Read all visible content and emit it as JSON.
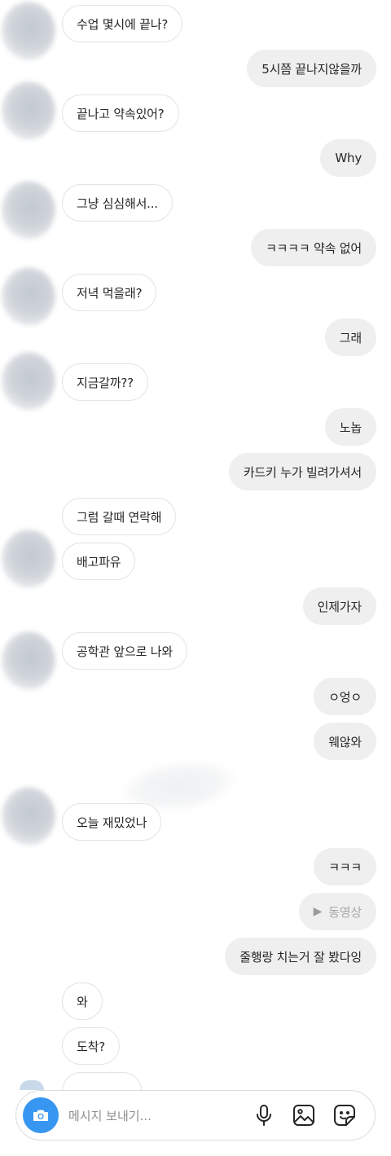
{
  "messages": [
    {
      "side": "in",
      "text": "수업 몇시에 끝나?"
    },
    {
      "side": "out",
      "text": "5시쯤 끝나지않을까"
    },
    {
      "side": "in",
      "text": "끝나고 약속있어?"
    },
    {
      "side": "out",
      "text": "Why"
    },
    {
      "side": "in",
      "text": "그냥 심심해서..."
    },
    {
      "side": "out",
      "text": "ㅋㅋㅋㅋ 약속 없어"
    },
    {
      "side": "in",
      "text": "저녁 먹을래?"
    },
    {
      "side": "out",
      "text": "그래"
    },
    {
      "side": "in",
      "text": "지금갈까??"
    },
    {
      "side": "out",
      "text": "노놉"
    },
    {
      "side": "out",
      "text": "카드키 누가 빌려가셔서"
    },
    {
      "side": "in",
      "text": "그럼 갈때 연락해"
    },
    {
      "side": "in",
      "text": "배고파유"
    },
    {
      "side": "out",
      "text": "인제가자"
    },
    {
      "side": "in",
      "text": "공학관 앞으로 나와"
    },
    {
      "side": "out",
      "text": "ㅇ엉ㅇ"
    },
    {
      "side": "out",
      "text": "웨않와"
    },
    {
      "side": "in",
      "text": "오늘 재밌었나"
    },
    {
      "side": "out",
      "text": "ㅋㅋㅋ"
    },
    {
      "side": "out",
      "text": "동영상",
      "type": "video"
    },
    {
      "side": "out",
      "text": "줄행랑 치는거 잘 봤다잉"
    },
    {
      "side": "in",
      "text": "와"
    },
    {
      "side": "in",
      "text": "도착?"
    }
  ],
  "composer": {
    "placeholder": "메시지 보내기...",
    "camera_icon": "camera-icon",
    "mic_icon": "microphone-icon",
    "gallery_icon": "image-icon",
    "sticker_icon": "sticker-icon",
    "accent": "#3797f0"
  }
}
